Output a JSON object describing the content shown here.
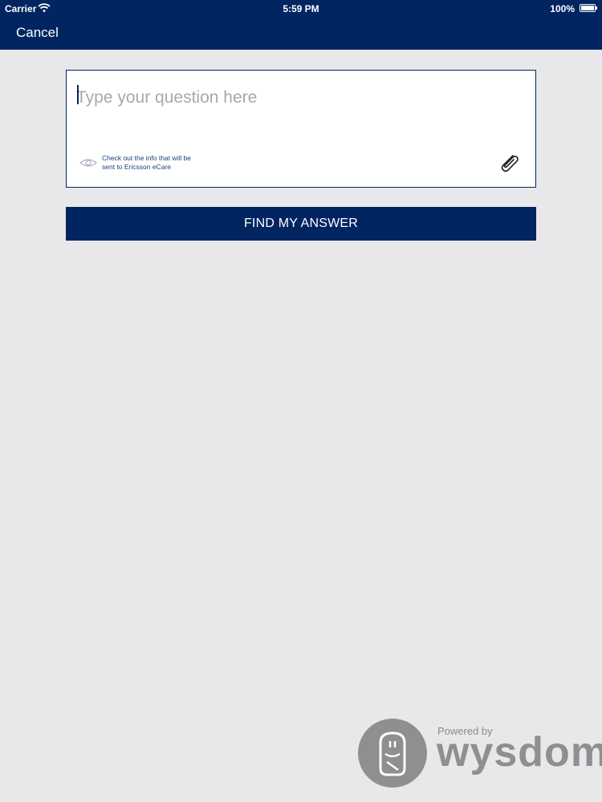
{
  "status_bar": {
    "carrier": "Carrier",
    "time": "5:59 PM",
    "battery": "100%"
  },
  "nav": {
    "cancel_label": "Cancel"
  },
  "question": {
    "placeholder": "Type your question here",
    "value": "",
    "info_link": "Check out the info that will be sent to Ericsson eCare"
  },
  "find_button_label": "FIND MY ANSWER",
  "footer": {
    "powered_by": "Powered by",
    "brand": "wysdom"
  },
  "colors": {
    "nav_background": "#002561",
    "page_background": "#e8e8ea",
    "brand_gray": "#8f8f92"
  },
  "icons": {
    "wifi": "wifi-icon",
    "battery": "battery-icon",
    "eye": "eye-icon",
    "attachment": "paperclip-icon",
    "logo": "wysdom-owl-icon"
  }
}
